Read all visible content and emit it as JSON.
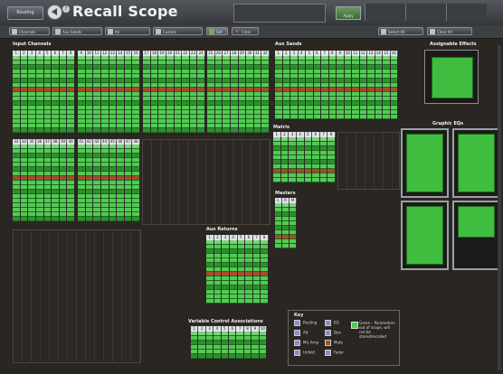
{
  "window": {
    "title": "Recall Scope",
    "left_button": "Routing",
    "right_button": "Apply"
  },
  "toolbar": {
    "buttons": [
      {
        "label": "Channels",
        "icon": "channel-icon"
      },
      {
        "label": "Aux Sends",
        "icon": "aux-icon"
      },
      {
        "label": "All",
        "icon": "all-icon"
      },
      {
        "label": "Custom",
        "icon": "custom-icon"
      },
      {
        "label": "Set",
        "icon": "check-icon",
        "selected": true
      },
      {
        "label": "Clear",
        "icon": "clear-icon"
      },
      {
        "label": "Select All",
        "icon": "select-all-icon"
      },
      {
        "label": "Clear All",
        "icon": "clear-all-icon"
      }
    ]
  },
  "sections": {
    "input_channels": {
      "label": "Input Channels",
      "banks": [
        [
          "1",
          "2",
          "3",
          "4",
          "5",
          "6",
          "7",
          "8"
        ],
        [
          "9",
          "10",
          "11",
          "12",
          "13",
          "14",
          "15",
          "16"
        ],
        [
          "17",
          "18",
          "19",
          "20",
          "21",
          "22",
          "23",
          "24"
        ],
        [
          "25",
          "26",
          "27",
          "28",
          "29",
          "30",
          "31",
          "32"
        ],
        [
          "33",
          "34",
          "35",
          "36",
          "37",
          "38",
          "39",
          "40"
        ],
        [
          "41",
          "42",
          "43",
          "44",
          "45",
          "46",
          "47",
          "48"
        ]
      ]
    },
    "aux_sends": {
      "label": "Aux Sends",
      "channels": [
        "1",
        "2",
        "3",
        "4",
        "5",
        "6",
        "7",
        "8",
        "9",
        "10",
        "11",
        "12",
        "13",
        "14",
        "15",
        "16"
      ]
    },
    "matrix": {
      "label": "Matrix",
      "channels": [
        "1",
        "2",
        "3",
        "4",
        "5",
        "6",
        "7",
        "8"
      ]
    },
    "masters": {
      "label": "Masters",
      "channels": [
        "L",
        "R",
        "M"
      ]
    },
    "aux_returns": {
      "label": "Aux Returns",
      "channels": [
        "1",
        "2",
        "3",
        "4",
        "5",
        "6",
        "7",
        "8"
      ]
    },
    "vca": {
      "label": "Variable Control Associations",
      "channels": [
        "1",
        "2",
        "3",
        "4",
        "5",
        "6",
        "7",
        "8",
        "9",
        "10"
      ]
    },
    "assignable_effects": {
      "label": "Assignable Effects"
    },
    "graphic_eqs": {
      "label": "Graphic EQs"
    }
  },
  "key": {
    "title": "Key",
    "items": [
      "Routing",
      "Alt",
      "Mic Amp",
      "Unfold",
      "EQ",
      "Dyn",
      "Mute",
      "Fader"
    ],
    "note": "Green – Parameters out of scope, will not be stored/recalled"
  },
  "colors": {
    "scope_green": "#55c955",
    "dark_green": "#2f8f2f",
    "mute_red": "#a84a2c",
    "background": "#2a2622"
  }
}
